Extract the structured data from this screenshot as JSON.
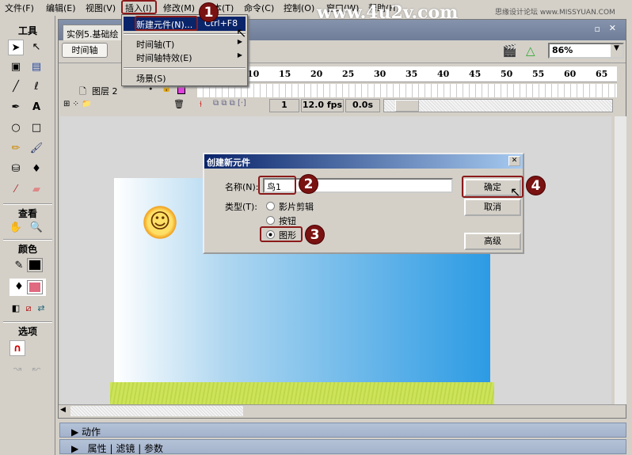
{
  "menubar": [
    "文件(F)",
    "编辑(E)",
    "视图(V)",
    "插入(I)",
    "修改(M)",
    "文本(T)",
    "命令(C)",
    "控制(O)",
    "窗口(W)",
    "帮助(H)"
  ],
  "watermark": {
    "site": "www.4u2v.com",
    "forum": "思缘设计论坛 www.MISSYUAN.COM"
  },
  "toolbox": {
    "title": "工具",
    "view": "查看",
    "colors": "颜色",
    "options": "选项",
    "stroke_color": "#000000",
    "fill_color": "#e06a80"
  },
  "document": {
    "tab": "实例5.基础绘",
    "timeline_button": "时间轴",
    "zoom": "86%"
  },
  "timeline": {
    "ruler": [
      "10",
      "15",
      "20",
      "25",
      "30",
      "35",
      "40",
      "45",
      "50",
      "55",
      "60",
      "65"
    ],
    "layer": "图层 2",
    "frame": "1",
    "fps": "12.0 fps",
    "time": "0.0s"
  },
  "insert_menu": {
    "items": [
      {
        "label": "新建元件(N)...",
        "shortcut": "Ctrl+F8"
      },
      {
        "label": "时间轴(T)"
      },
      {
        "label": "时间轴特效(E)"
      },
      {
        "label": "场景(S)"
      }
    ]
  },
  "dialog": {
    "title": "创建新元件",
    "name_label": "名称(N):",
    "name_value": "鸟1",
    "type_label": "类型(T):",
    "types": [
      "影片剪辑",
      "按钮",
      "图形"
    ],
    "selected_type": "图形",
    "ok": "确定",
    "cancel": "取消",
    "advanced": "高级"
  },
  "badges": [
    "1",
    "2",
    "3",
    "4"
  ],
  "panels": {
    "actions": "动作",
    "tabs": [
      "属性",
      "滤镜",
      "参数"
    ]
  }
}
